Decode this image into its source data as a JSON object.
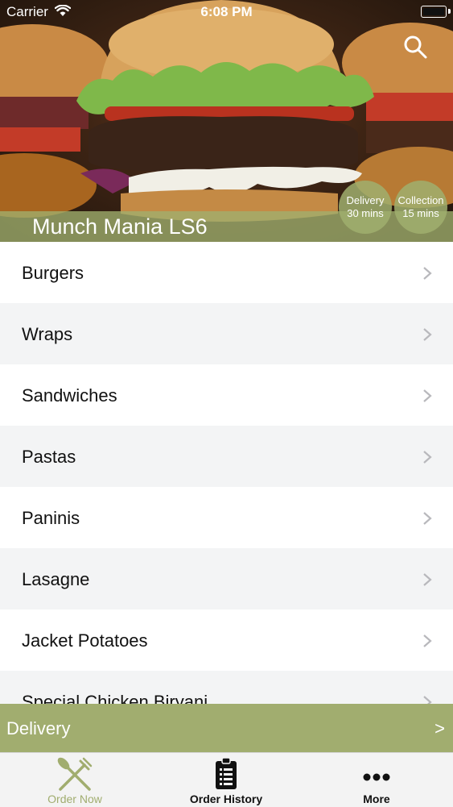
{
  "status_bar": {
    "carrier": "Carrier",
    "time": "6:08 PM"
  },
  "header": {
    "restaurant_name": "Munch Mania LS6",
    "delivery_badge": {
      "label": "Delivery",
      "time": "30 mins"
    },
    "collection_badge": {
      "label": "Collection",
      "time": "15 mins"
    }
  },
  "menu": {
    "items": [
      {
        "label": "Burgers"
      },
      {
        "label": "Wraps"
      },
      {
        "label": "Sandwiches"
      },
      {
        "label": "Pastas"
      },
      {
        "label": "Paninis"
      },
      {
        "label": "Lasagne"
      },
      {
        "label": "Jacket Potatoes"
      },
      {
        "label": "Special Chicken Biryani"
      }
    ]
  },
  "order_bar": {
    "label": "Delivery",
    "arrow": ">"
  },
  "tabs": [
    {
      "label": "Order Now",
      "icon": "fork-knife-icon",
      "active": true
    },
    {
      "label": "Order History",
      "icon": "clipboard-list-icon",
      "active": false
    },
    {
      "label": "More",
      "icon": "more-dots-icon",
      "active": false
    }
  ],
  "colors": {
    "accent": "#a1ad6f",
    "stripe": "#f3f4f5",
    "tab_bar": "#f3f3f3"
  }
}
